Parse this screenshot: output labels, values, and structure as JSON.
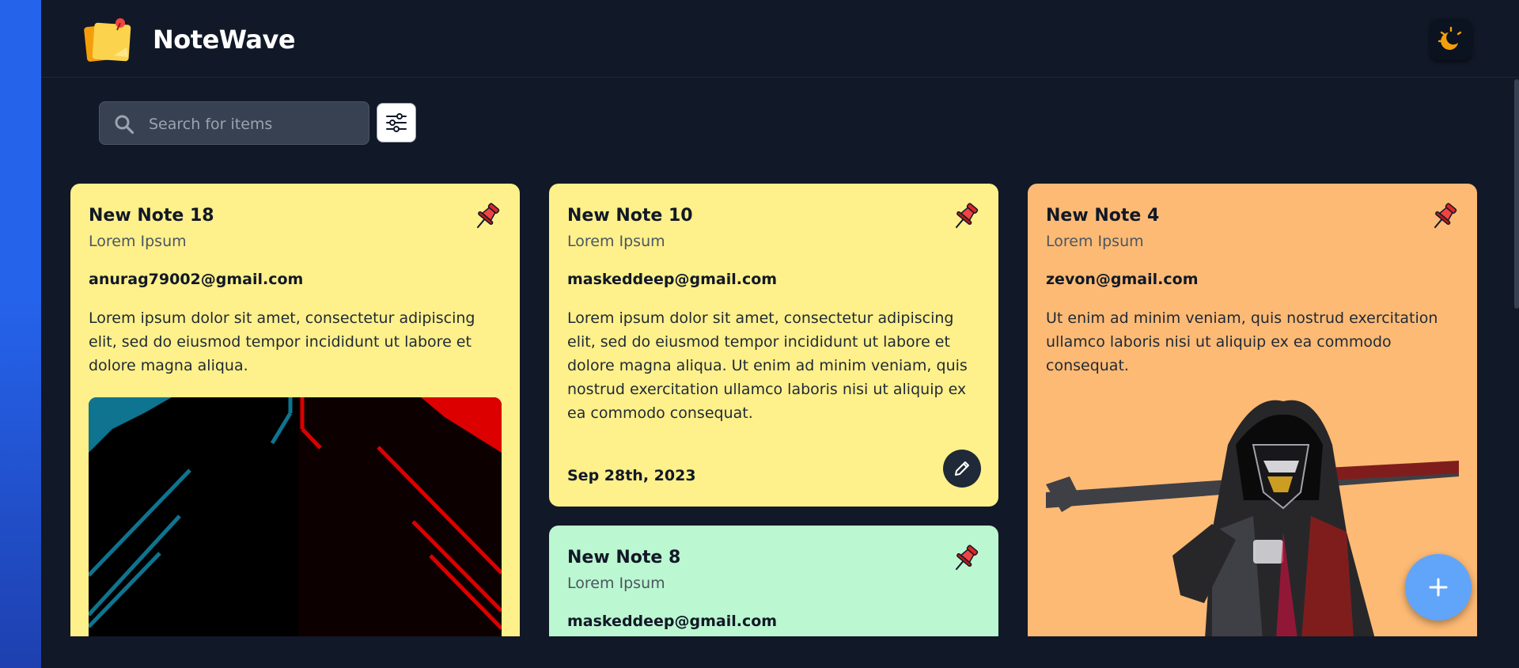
{
  "app": {
    "name": "NoteWave"
  },
  "header": {
    "theme_toggle_icon": "moon-sun-icon"
  },
  "search": {
    "placeholder": "Search for items",
    "value": ""
  },
  "filter": {
    "icon": "sliders-icon"
  },
  "notes": [
    {
      "title": "New Note 18",
      "subtitle": "Lorem Ipsum",
      "email": "anurag79002@gmail.com",
      "body": "Lorem ipsum dolor sit amet, consectetur adipiscing elit, sed do eiusmod tempor incididunt ut labore et dolore magna aliqua.",
      "color": "#fef08a",
      "image": "abstract-neon-lines"
    },
    {
      "title": "New Note 10",
      "subtitle": "Lorem Ipsum",
      "email": "maskeddeep@gmail.com",
      "body": "Lorem ipsum dolor sit amet, consectetur adipiscing elit, sed do eiusmod tempor incididunt ut labore et dolore magna aliqua. Ut enim ad minim veniam, quis nostrud exercitation ullamco laboris nisi ut aliquip ex ea commodo consequat.",
      "date": "Sep 28th, 2023",
      "color": "#fef08a"
    },
    {
      "title": "New Note 8",
      "subtitle": "Lorem Ipsum",
      "email": "maskeddeep@gmail.com",
      "color": "#bbf7d0"
    },
    {
      "title": "New Note 4",
      "subtitle": "Lorem Ipsum",
      "email": "zevon@gmail.com",
      "body": "Ut enim ad minim veniam, quis nostrud exercitation ullamco laboris nisi ut aliquip ex ea commodo consequat.",
      "color": "#fdba74",
      "image": "cyberpunk-hooded-warrior"
    }
  ],
  "fab": {
    "label": "+"
  }
}
